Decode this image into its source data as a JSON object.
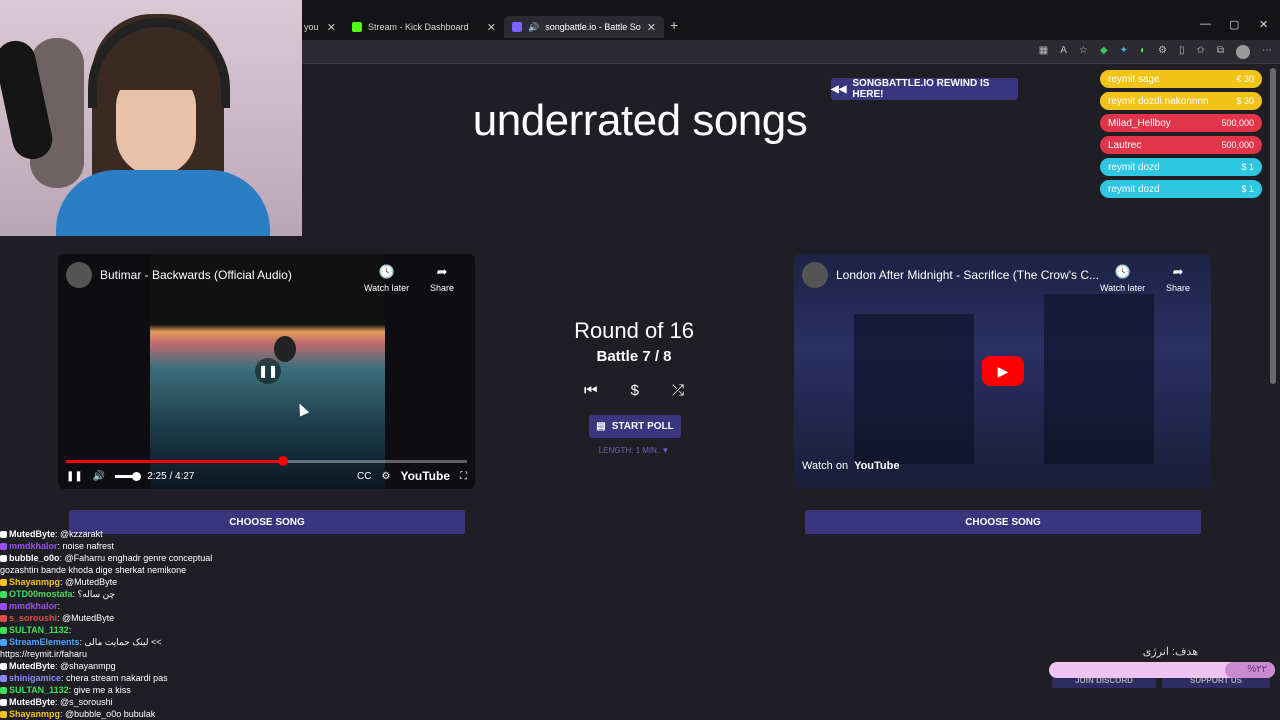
{
  "browser": {
    "tabs": [
      {
        "label": "you",
        "active": false
      },
      {
        "label": "Stream - Kick Dashboard",
        "active": false
      },
      {
        "label": "songbattle.io - Battle Songs",
        "active": true
      }
    ],
    "new_tab": "+",
    "window_controls": {
      "minimize": "—",
      "maximize": "▢",
      "close": "✕"
    },
    "colors": {
      "kick_green": "#53fc18",
      "tab_active_bg": "#2c2b31"
    }
  },
  "header": {
    "rewind_label": "SONGBATTLE.IO REWIND IS HERE!",
    "title": "underrated songs"
  },
  "alerts": [
    {
      "name": "reymit sage",
      "amount": "€ 30",
      "color": "#f2c41a"
    },
    {
      "name": "reymit dozdi nakonnnn",
      "amount": "$ 30",
      "color": "#f2c41a"
    },
    {
      "name": "Milad_Hellboy",
      "amount": "500,000",
      "color": "#e2354a"
    },
    {
      "name": "Lautrec",
      "amount": "500,000",
      "color": "#e2354a"
    },
    {
      "name": "reymit dozd",
      "amount": "$ 1",
      "color": "#2ec6e0"
    },
    {
      "name": "reymit dozd",
      "amount": "$ 1",
      "color": "#2ec6e0"
    }
  ],
  "left_video": {
    "title": "Butimar - Backwards (Official Audio)",
    "watch_later": "Watch later",
    "share": "Share",
    "time": "2:25 / 4:27",
    "progress": 0.54,
    "brand": "YouTube",
    "choose_label": "CHOOSE SONG"
  },
  "right_video": {
    "title": "London After Midnight - Sacrifice (The Crow's C...",
    "watch_later": "Watch later",
    "share": "Share",
    "watch_on": "Watch on",
    "brand": "YouTube",
    "choose_label": "CHOOSE SONG"
  },
  "battle": {
    "round": "Round of 16",
    "battle": "Battle 7 / 8",
    "start_poll": "START POLL",
    "length": "LENGTH: 1 MIN. ▼"
  },
  "chat": [
    {
      "user": "MutedByte",
      "text": ": @kzzarakt",
      "color": "#ffffff"
    },
    {
      "user": "mmdkhalor",
      "text": ": noise nafrest",
      "color": "#9b4dff"
    },
    {
      "user": "bubble_o0o",
      "text": ": @Faharru enghadr genre conceptual",
      "color": "#ffffff"
    },
    {
      "user": "",
      "text": "gozashtin bande khoda dige sherkat nemikone",
      "color": "#ffffff"
    },
    {
      "user": "Shayanmpg",
      "text": ": @MutedByte",
      "color": "#f5c518"
    },
    {
      "user": "OTD00mostafa",
      "text": ": چن ساله؟",
      "color": "#3de05a"
    },
    {
      "user": "mmdkhalor",
      "text": ":",
      "color": "#9b4dff"
    },
    {
      "user": "s_soroushi",
      "text": ": @MutedByte",
      "color": "#e24b4b"
    },
    {
      "user": "SULTAN_1132",
      "text": ":",
      "color": "#3de05a"
    },
    {
      "user": "StreamElements",
      "text": ": لینک حمایت مالی <<",
      "color": "#4aa3ff"
    },
    {
      "user": "",
      "text": "https://reymit.ir/faharu",
      "color": "#ffffff"
    },
    {
      "user": "MutedByte",
      "text": ": @shayanmpg",
      "color": "#ffffff"
    },
    {
      "user": "shinigamice",
      "text": ": chera stream nakardi pas",
      "color": "#8a8aff"
    },
    {
      "user": "SULTAN_1132",
      "text": ": give me a kiss",
      "color": "#3de05a"
    },
    {
      "user": "MutedByte",
      "text": ": @s_soroushi",
      "color": "#ffffff"
    },
    {
      "user": "Shayanmpg",
      "text": ": @bubble_o0o bubulak",
      "color": "#f5c518"
    }
  ],
  "goal": {
    "label": "هدف: انرژی",
    "percent_text": "%۲۲",
    "progress": 0.22
  },
  "footer": {
    "join_discord": "JOIN DISCORD",
    "support_us": "SUPPORT US"
  }
}
